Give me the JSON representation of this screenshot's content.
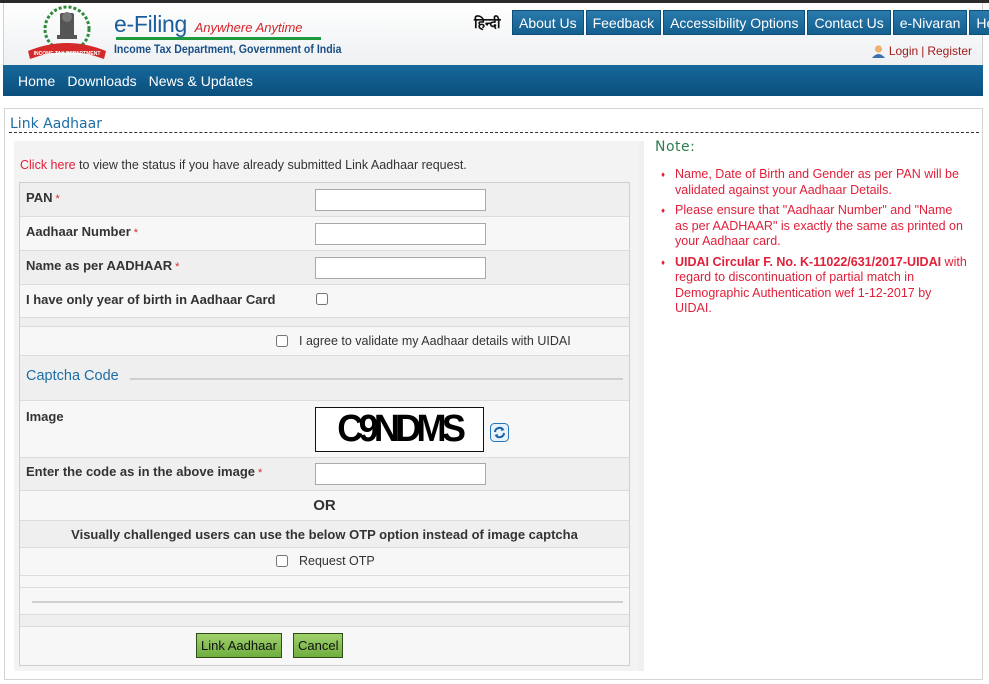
{
  "header": {
    "brand_title": "e-Filing",
    "brand_tagline": "Anywhere Anytime",
    "brand_subtitle": "Income Tax Department, Government of India",
    "emblem_ribbon_text": "INCOME TAX DEPARTMENT",
    "language_link": "हिन्दी",
    "top_nav": [
      "About Us",
      "Feedback",
      "Accessibility Options",
      "Contact Us",
      "e-Nivaran",
      "Help"
    ],
    "login_label": "Login",
    "separator": "|",
    "register_label": "Register"
  },
  "main_nav": [
    "Home",
    "Downloads",
    "News & Updates"
  ],
  "page": {
    "title": "Link Aadhaar",
    "status_link": "Click here",
    "status_text": " to view the status if you have already submitted Link Aadhaar request."
  },
  "form": {
    "required_marker": "*",
    "pan_label": "PAN",
    "pan_value": "",
    "aadhaar_label": "Aadhaar Number",
    "aadhaar_value": "",
    "name_label": "Name as per AADHAAR",
    "name_value": "",
    "yob_label": "I have only year of birth in Aadhaar Card",
    "yob_checked": false,
    "agree_label": "I agree to validate my Aadhaar details with UIDAI",
    "agree_checked": false,
    "captcha_legend": "Captcha Code",
    "image_label": "Image",
    "captcha_text": "C9NDMS",
    "code_label": "Enter the code as in the above image",
    "code_value": "",
    "or_text": "OR",
    "otp_hint": "Visually challenged users can use the below OTP option instead of image captcha",
    "otp_label": "Request OTP",
    "otp_checked": false,
    "submit_label": "Link Aadhaar",
    "cancel_label": "Cancel"
  },
  "note": {
    "title": "Note:",
    "items": [
      {
        "bold": "",
        "text": "Name, Date of Birth and Gender as per PAN will be validated against your Aadhaar Details."
      },
      {
        "bold": "",
        "text": "Please ensure that \"Aadhaar Number\" and \"Name as per AADHAAR\" is exactly the same as printed on your Aadhaar card."
      },
      {
        "bold": "UIDAI Circular F. No. K-11022/631/2017-UIDAI",
        "text": " with regard to discontinuation of partial match in Demographic Authentication wef 1-12-2017 by UIDAI."
      }
    ]
  },
  "colors": {
    "nav_blue": "#14608f",
    "link_red": "#e0203a",
    "title_blue": "#1c6ea4",
    "note_green": "#2f7d4e",
    "button_green": "#7fbb4a"
  }
}
